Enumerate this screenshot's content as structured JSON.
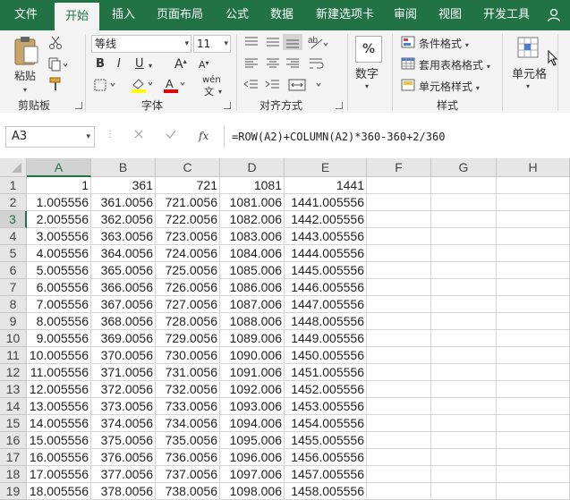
{
  "tabs": [
    {
      "label": "文件",
      "active": false
    },
    {
      "label": "开始",
      "active": true
    },
    {
      "label": "插入",
      "active": false
    },
    {
      "label": "页面布局",
      "active": false
    },
    {
      "label": "公式",
      "active": false
    },
    {
      "label": "数据",
      "active": false
    },
    {
      "label": "新建选项卡",
      "active": false
    },
    {
      "label": "审阅",
      "active": false
    },
    {
      "label": "视图",
      "active": false
    },
    {
      "label": "开发工具",
      "active": false
    }
  ],
  "ribbon": {
    "clipboard": {
      "paste_label": "粘贴",
      "group_label": "剪贴板"
    },
    "font": {
      "font_name": "等线",
      "font_size": "11",
      "bold": "B",
      "italic": "I",
      "underline": "U",
      "grow": "A",
      "shrink": "A",
      "wen": "wén",
      "group_label": "字体"
    },
    "alignment": {
      "group_label": "对齐方式"
    },
    "number": {
      "label": "数字",
      "symbol": "%"
    },
    "styles": {
      "conditional": "条件格式",
      "table_format": "套用表格格式",
      "cell_styles": "单元格样式",
      "group_label": "样式"
    },
    "cells": {
      "label": "单元格"
    }
  },
  "formula_bar": {
    "name_box": "A3",
    "fx": "fx",
    "formula": "=ROW(A2)+COLUMN(A2)*360-360+2/360"
  },
  "columns": [
    "A",
    "B",
    "C",
    "D",
    "E",
    "F",
    "G",
    "H"
  ],
  "rows": [
    {
      "n": "1",
      "a": "1",
      "b": "361",
      "c": "721",
      "d": "1081",
      "e": "1441"
    },
    {
      "n": "2",
      "a": "1.005556",
      "b": "361.0056",
      "c": "721.0056",
      "d": "1081.006",
      "e": "1441.005556"
    },
    {
      "n": "3",
      "a": "2.005556",
      "b": "362.0056",
      "c": "722.0056",
      "d": "1082.006",
      "e": "1442.005556"
    },
    {
      "n": "4",
      "a": "3.005556",
      "b": "363.0056",
      "c": "723.0056",
      "d": "1083.006",
      "e": "1443.005556"
    },
    {
      "n": "5",
      "a": "4.005556",
      "b": "364.0056",
      "c": "724.0056",
      "d": "1084.006",
      "e": "1444.005556"
    },
    {
      "n": "6",
      "a": "5.005556",
      "b": "365.0056",
      "c": "725.0056",
      "d": "1085.006",
      "e": "1445.005556"
    },
    {
      "n": "7",
      "a": "6.005556",
      "b": "366.0056",
      "c": "726.0056",
      "d": "1086.006",
      "e": "1446.005556"
    },
    {
      "n": "8",
      "a": "7.005556",
      "b": "367.0056",
      "c": "727.0056",
      "d": "1087.006",
      "e": "1447.005556"
    },
    {
      "n": "9",
      "a": "8.005556",
      "b": "368.0056",
      "c": "728.0056",
      "d": "1088.006",
      "e": "1448.005556"
    },
    {
      "n": "10",
      "a": "9.005556",
      "b": "369.0056",
      "c": "729.0056",
      "d": "1089.006",
      "e": "1449.005556"
    },
    {
      "n": "11",
      "a": "10.005556",
      "b": "370.0056",
      "c": "730.0056",
      "d": "1090.006",
      "e": "1450.005556"
    },
    {
      "n": "12",
      "a": "11.005556",
      "b": "371.0056",
      "c": "731.0056",
      "d": "1091.006",
      "e": "1451.005556"
    },
    {
      "n": "13",
      "a": "12.005556",
      "b": "372.0056",
      "c": "732.0056",
      "d": "1092.006",
      "e": "1452.005556"
    },
    {
      "n": "14",
      "a": "13.005556",
      "b": "373.0056",
      "c": "733.0056",
      "d": "1093.006",
      "e": "1453.005556"
    },
    {
      "n": "15",
      "a": "14.005556",
      "b": "374.0056",
      "c": "734.0056",
      "d": "1094.006",
      "e": "1454.005556"
    },
    {
      "n": "16",
      "a": "15.005556",
      "b": "375.0056",
      "c": "735.0056",
      "d": "1095.006",
      "e": "1455.005556"
    },
    {
      "n": "17",
      "a": "16.005556",
      "b": "376.0056",
      "c": "736.0056",
      "d": "1096.006",
      "e": "1456.005556"
    },
    {
      "n": "18",
      "a": "17.005556",
      "b": "377.0056",
      "c": "737.0056",
      "d": "1097.006",
      "e": "1457.005556"
    },
    {
      "n": "19",
      "a": "18.005556",
      "b": "378.0056",
      "c": "738.0056",
      "d": "1098.006",
      "e": "1458.005556"
    }
  ],
  "selected_cell": {
    "col": "A",
    "row": "3"
  },
  "colors": {
    "brand": "#217346",
    "font_highlight": "#ffff00",
    "font_color": "#e00000"
  }
}
